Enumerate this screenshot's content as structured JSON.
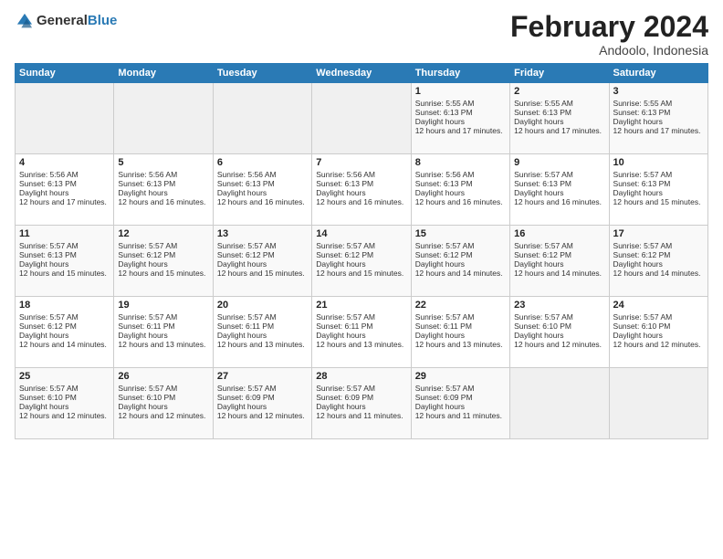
{
  "header": {
    "logo_general": "General",
    "logo_blue": "Blue",
    "month_title": "February 2024",
    "location": "Andoolo, Indonesia"
  },
  "days_of_week": [
    "Sunday",
    "Monday",
    "Tuesday",
    "Wednesday",
    "Thursday",
    "Friday",
    "Saturday"
  ],
  "weeks": [
    [
      {
        "day": "",
        "empty": true
      },
      {
        "day": "",
        "empty": true
      },
      {
        "day": "",
        "empty": true
      },
      {
        "day": "",
        "empty": true
      },
      {
        "day": "1",
        "sunrise": "5:55 AM",
        "sunset": "6:13 PM",
        "daylight": "12 hours and 17 minutes."
      },
      {
        "day": "2",
        "sunrise": "5:55 AM",
        "sunset": "6:13 PM",
        "daylight": "12 hours and 17 minutes."
      },
      {
        "day": "3",
        "sunrise": "5:55 AM",
        "sunset": "6:13 PM",
        "daylight": "12 hours and 17 minutes."
      }
    ],
    [
      {
        "day": "4",
        "sunrise": "5:56 AM",
        "sunset": "6:13 PM",
        "daylight": "12 hours and 17 minutes."
      },
      {
        "day": "5",
        "sunrise": "5:56 AM",
        "sunset": "6:13 PM",
        "daylight": "12 hours and 16 minutes."
      },
      {
        "day": "6",
        "sunrise": "5:56 AM",
        "sunset": "6:13 PM",
        "daylight": "12 hours and 16 minutes."
      },
      {
        "day": "7",
        "sunrise": "5:56 AM",
        "sunset": "6:13 PM",
        "daylight": "12 hours and 16 minutes."
      },
      {
        "day": "8",
        "sunrise": "5:56 AM",
        "sunset": "6:13 PM",
        "daylight": "12 hours and 16 minutes."
      },
      {
        "day": "9",
        "sunrise": "5:57 AM",
        "sunset": "6:13 PM",
        "daylight": "12 hours and 16 minutes."
      },
      {
        "day": "10",
        "sunrise": "5:57 AM",
        "sunset": "6:13 PM",
        "daylight": "12 hours and 15 minutes."
      }
    ],
    [
      {
        "day": "11",
        "sunrise": "5:57 AM",
        "sunset": "6:13 PM",
        "daylight": "12 hours and 15 minutes."
      },
      {
        "day": "12",
        "sunrise": "5:57 AM",
        "sunset": "6:12 PM",
        "daylight": "12 hours and 15 minutes."
      },
      {
        "day": "13",
        "sunrise": "5:57 AM",
        "sunset": "6:12 PM",
        "daylight": "12 hours and 15 minutes."
      },
      {
        "day": "14",
        "sunrise": "5:57 AM",
        "sunset": "6:12 PM",
        "daylight": "12 hours and 15 minutes."
      },
      {
        "day": "15",
        "sunrise": "5:57 AM",
        "sunset": "6:12 PM",
        "daylight": "12 hours and 14 minutes."
      },
      {
        "day": "16",
        "sunrise": "5:57 AM",
        "sunset": "6:12 PM",
        "daylight": "12 hours and 14 minutes."
      },
      {
        "day": "17",
        "sunrise": "5:57 AM",
        "sunset": "6:12 PM",
        "daylight": "12 hours and 14 minutes."
      }
    ],
    [
      {
        "day": "18",
        "sunrise": "5:57 AM",
        "sunset": "6:12 PM",
        "daylight": "12 hours and 14 minutes."
      },
      {
        "day": "19",
        "sunrise": "5:57 AM",
        "sunset": "6:11 PM",
        "daylight": "12 hours and 13 minutes."
      },
      {
        "day": "20",
        "sunrise": "5:57 AM",
        "sunset": "6:11 PM",
        "daylight": "12 hours and 13 minutes."
      },
      {
        "day": "21",
        "sunrise": "5:57 AM",
        "sunset": "6:11 PM",
        "daylight": "12 hours and 13 minutes."
      },
      {
        "day": "22",
        "sunrise": "5:57 AM",
        "sunset": "6:11 PM",
        "daylight": "12 hours and 13 minutes."
      },
      {
        "day": "23",
        "sunrise": "5:57 AM",
        "sunset": "6:10 PM",
        "daylight": "12 hours and 12 minutes."
      },
      {
        "day": "24",
        "sunrise": "5:57 AM",
        "sunset": "6:10 PM",
        "daylight": "12 hours and 12 minutes."
      }
    ],
    [
      {
        "day": "25",
        "sunrise": "5:57 AM",
        "sunset": "6:10 PM",
        "daylight": "12 hours and 12 minutes."
      },
      {
        "day": "26",
        "sunrise": "5:57 AM",
        "sunset": "6:10 PM",
        "daylight": "12 hours and 12 minutes."
      },
      {
        "day": "27",
        "sunrise": "5:57 AM",
        "sunset": "6:09 PM",
        "daylight": "12 hours and 12 minutes."
      },
      {
        "day": "28",
        "sunrise": "5:57 AM",
        "sunset": "6:09 PM",
        "daylight": "12 hours and 11 minutes."
      },
      {
        "day": "29",
        "sunrise": "5:57 AM",
        "sunset": "6:09 PM",
        "daylight": "12 hours and 11 minutes."
      },
      {
        "day": "",
        "empty": true
      },
      {
        "day": "",
        "empty": true
      }
    ]
  ],
  "cell_labels": {
    "sunrise": "Sunrise:",
    "sunset": "Sunset:",
    "daylight": "Daylight hours"
  }
}
